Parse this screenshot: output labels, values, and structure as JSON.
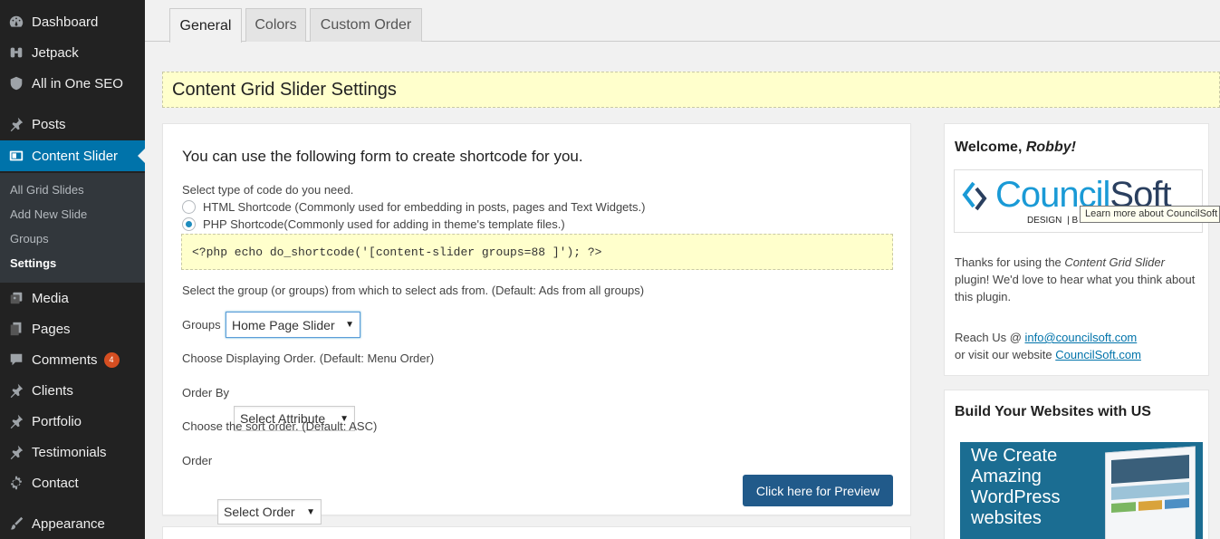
{
  "sidebar": {
    "items": [
      {
        "label": "Dashboard",
        "icon": "dashboard-icon"
      },
      {
        "label": "Jetpack",
        "icon": "jetpack-icon"
      },
      {
        "label": "All in One SEO",
        "icon": "shield-icon"
      },
      {
        "label": "Posts",
        "icon": "pin-icon"
      },
      {
        "label": "Content Slider",
        "icon": "slider-icon"
      },
      {
        "label": "Media",
        "icon": "media-icon"
      },
      {
        "label": "Pages",
        "icon": "pages-icon"
      },
      {
        "label": "Comments",
        "icon": "comment-icon",
        "badge": "4"
      },
      {
        "label": "Clients",
        "icon": "pin-icon"
      },
      {
        "label": "Portfolio",
        "icon": "pin-icon"
      },
      {
        "label": "Testimonials",
        "icon": "pin-icon"
      },
      {
        "label": "Contact",
        "icon": "gear-icon"
      },
      {
        "label": "Appearance",
        "icon": "brush-icon"
      }
    ],
    "submenu": [
      "All Grid Slides",
      "Add New Slide",
      "Groups",
      "Settings"
    ]
  },
  "tabs": [
    "General",
    "Colors",
    "Custom Order"
  ],
  "settings_title": "Content Grid Slider Settings",
  "form": {
    "title": "You can use the following form to create shortcode for you.",
    "code_type_label": "Select type of code do you need.",
    "radio_html": "HTML Shortcode (Commonly used for embedding in posts, pages and Text Widgets.)",
    "radio_php": "PHP Shortcode(Commonly used for adding in theme's template files.)",
    "shortcode": "<?php echo do_shortcode('[content-slider groups=88 ]'); ?>",
    "group_help": "Select the group (or groups) from which to select ads from. (Default: Ads from all groups)",
    "groups_label": "Groups",
    "groups_value": "Home Page Slider",
    "display_order_help": "Choose Displaying Order. (Default: Menu Order)",
    "order_by_label": "Order By",
    "order_by_value": "Select Attribute",
    "sort_help": "Choose the sort order. (Default: ASC)",
    "order_label": "Order",
    "order_value": "Select Order",
    "preview_button": "Click here for Preview"
  },
  "welcome": {
    "title_prefix": "Welcome, ",
    "user": "Robby!",
    "logo_text_1": "Council",
    "logo_text_2": "Soft",
    "logo_tagline_1": "DESIGN",
    "logo_tagline_2": "| B",
    "tooltip": "Learn more about CouncilSoft",
    "thanks_1": "Thanks for using the ",
    "thanks_plugin": "Content Grid Slider",
    "thanks_2": "plugin! We'd love to hear what you think about this plugin.",
    "reach_label": "Reach Us @ ",
    "email": "info@councilsoft.com",
    "visit_label": "or visit our website ",
    "website": "CouncilSoft.com"
  },
  "build": {
    "title": "Build Your Websites with US",
    "promo_text": [
      "We Create",
      "Amazing",
      "WordPress",
      "websites"
    ]
  },
  "colors": {
    "sidebar_bg": "#222222",
    "accent": "#0073aa",
    "button": "#215a8a",
    "highlight_bg": "#ffffcc"
  }
}
